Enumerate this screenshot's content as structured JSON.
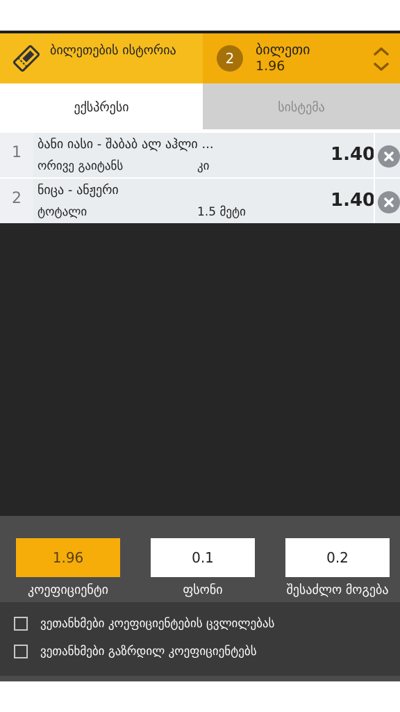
{
  "header": {
    "history_label": "ბილეთების ისტორია",
    "ticket_count": "2",
    "ticket_title": "ბილეთი",
    "ticket_odds": "1.96"
  },
  "tabs": [
    {
      "label": "ექსპრესი",
      "active": true
    },
    {
      "label": "სისტემა",
      "active": false
    }
  ],
  "bets": [
    {
      "number": "1",
      "match": "ბანი იასი - შაბაბ ალ აჰლი ...",
      "market": "ორივე გაიტანს",
      "selection": "კი",
      "odds": "1.40"
    },
    {
      "number": "2",
      "match": "ნიცა - ანჟერი",
      "market": "ტოტალი",
      "selection": "1.5 მეტი",
      "odds": "1.40"
    }
  ],
  "summary": {
    "coefficient_value": "1.96",
    "coefficient_label": "კოეფიციენტი",
    "stake_value": "0.1",
    "stake_label": "ფსონი",
    "possible_win_value": "0.2",
    "possible_win_label": "შესაძლო მოგება"
  },
  "options": {
    "accept_changes": "ვეთანხმები კოეფიციენტების ცვლილებას",
    "accept_increased": "ვეთანხმები გაზრდილ კოეფიციენტებს"
  },
  "colors": {
    "accent": "#f6ad0a",
    "header_left": "#f6bc1c",
    "dark_bg": "#262626"
  },
  "icons": {
    "history": "ticket-icon",
    "expand": "chevron-up-down-icon",
    "remove": "close-icon"
  }
}
